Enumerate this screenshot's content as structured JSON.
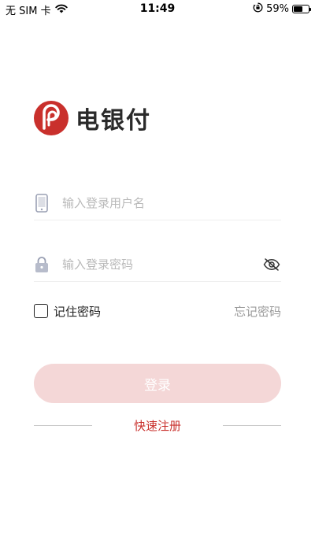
{
  "status_bar": {
    "carrier": "无 SIM 卡",
    "time": "11:49",
    "battery_percent": "59%",
    "battery_level": 0.59,
    "icons": [
      "wifi-icon",
      "orientation-lock-icon",
      "battery-icon"
    ]
  },
  "brand": {
    "name": "电银付",
    "color": "#c9302c"
  },
  "login_form": {
    "username_placeholder": "输入登录用户名",
    "password_placeholder": "输入登录密码",
    "remember_label": "记住密码",
    "remember_checked": false,
    "forgot_label": "忘记密码",
    "login_label": "登录",
    "register_label": "快速注册"
  },
  "colors": {
    "accent": "#c9302c",
    "button_disabled_bg": "#f4d7d7",
    "placeholder": "#b9b9b9",
    "icon_gray": "#9aa0b4"
  }
}
